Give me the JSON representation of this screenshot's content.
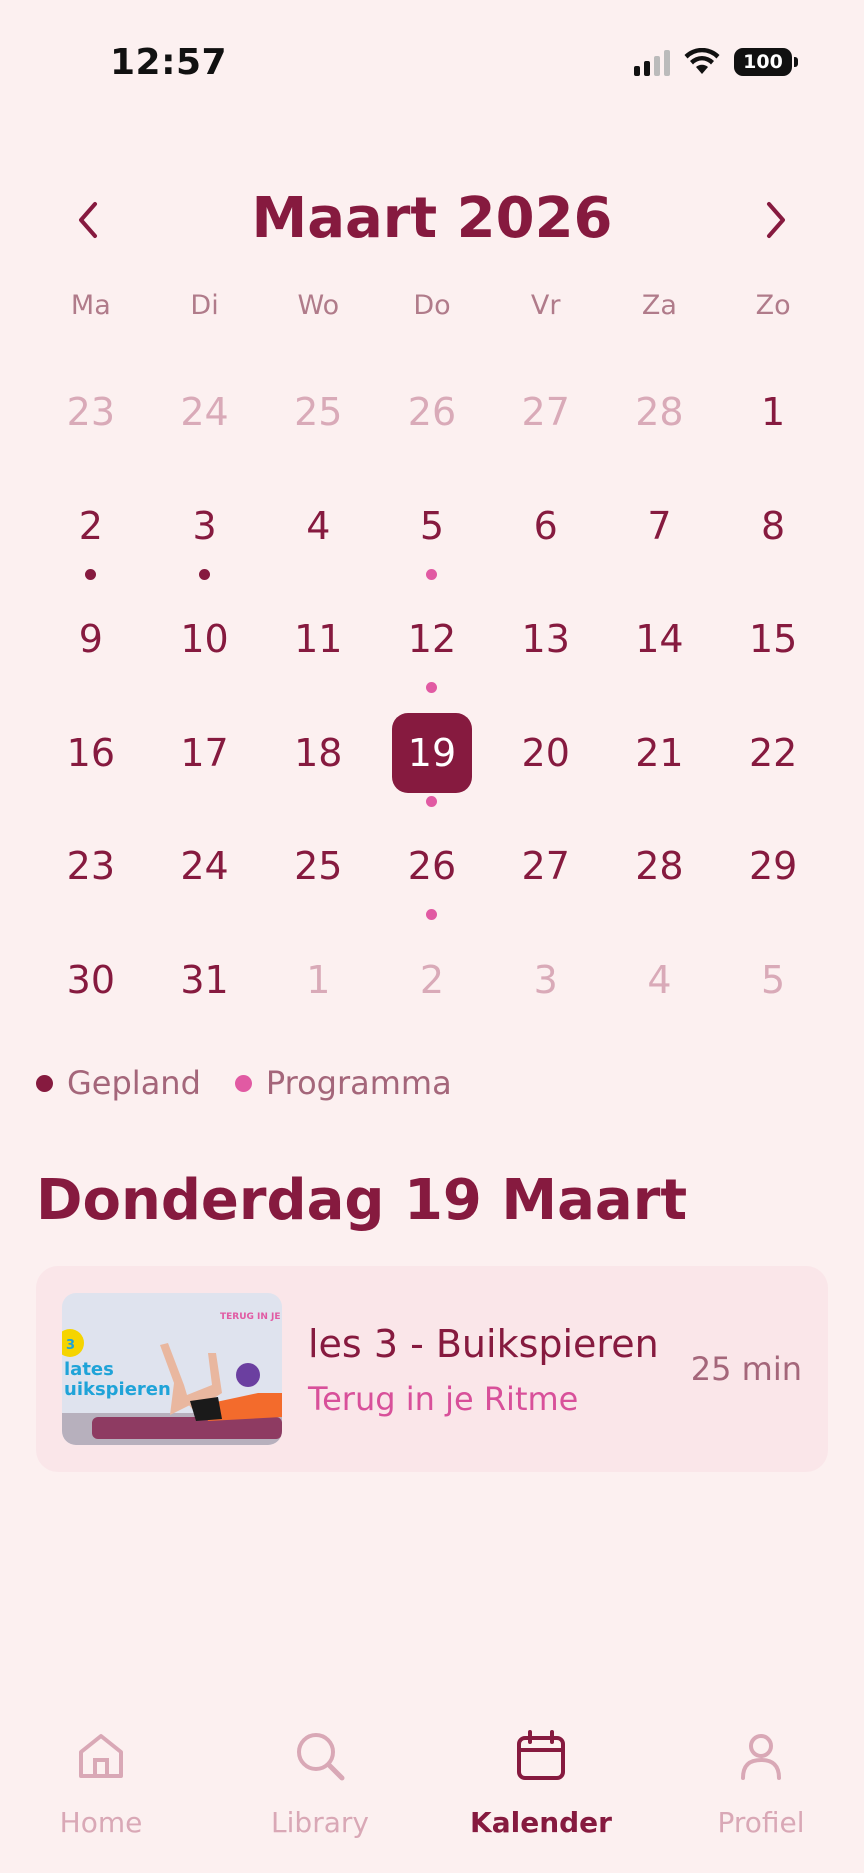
{
  "status": {
    "time": "12:57",
    "battery": "100"
  },
  "calendar": {
    "month_title": "Maart 2026",
    "weekdays": [
      "Ma",
      "Di",
      "Wo",
      "Do",
      "Vr",
      "Za",
      "Zo"
    ],
    "days": [
      {
        "n": "23",
        "muted": true
      },
      {
        "n": "24",
        "muted": true
      },
      {
        "n": "25",
        "muted": true
      },
      {
        "n": "26",
        "muted": true
      },
      {
        "n": "27",
        "muted": true
      },
      {
        "n": "28",
        "muted": true
      },
      {
        "n": "1"
      },
      {
        "n": "2",
        "dot": "gepland"
      },
      {
        "n": "3",
        "dot": "gepland"
      },
      {
        "n": "4"
      },
      {
        "n": "5",
        "dot": "programma"
      },
      {
        "n": "6"
      },
      {
        "n": "7"
      },
      {
        "n": "8"
      },
      {
        "n": "9"
      },
      {
        "n": "10"
      },
      {
        "n": "11"
      },
      {
        "n": "12",
        "dot": "programma"
      },
      {
        "n": "13"
      },
      {
        "n": "14"
      },
      {
        "n": "15"
      },
      {
        "n": "16"
      },
      {
        "n": "17"
      },
      {
        "n": "18"
      },
      {
        "n": "19",
        "selected": true,
        "dot": "programma"
      },
      {
        "n": "20"
      },
      {
        "n": "21"
      },
      {
        "n": "22"
      },
      {
        "n": "23"
      },
      {
        "n": "24"
      },
      {
        "n": "25"
      },
      {
        "n": "26",
        "dot": "programma"
      },
      {
        "n": "27"
      },
      {
        "n": "28"
      },
      {
        "n": "29"
      },
      {
        "n": "30"
      },
      {
        "n": "31"
      },
      {
        "n": "1",
        "muted": true
      },
      {
        "n": "2",
        "muted": true
      },
      {
        "n": "3",
        "muted": true
      },
      {
        "n": "4",
        "muted": true
      },
      {
        "n": "5",
        "muted": true
      }
    ]
  },
  "legend": {
    "gepland": "Gepland",
    "programma": "Programma"
  },
  "selected_day_title": "Donderdag 19 Maart",
  "session": {
    "title": "les 3 - Buikspieren",
    "subtitle": "Terug in je Ritme",
    "duration": "25 min",
    "thumb_banner": "TERUG IN JE RIT",
    "thumb_text_1": "lates",
    "thumb_text_2": "uikspieren",
    "thumb_badge": "3"
  },
  "tabs": [
    {
      "label": "Home",
      "icon": "home-icon"
    },
    {
      "label": "Library",
      "icon": "search-icon"
    },
    {
      "label": "Kalender",
      "icon": "calendar-icon",
      "active": true
    },
    {
      "label": "Profiel",
      "icon": "person-icon"
    }
  ],
  "colors": {
    "accent": "#861a3f",
    "pink": "#e15aa3",
    "background": "#fcf0f0"
  }
}
